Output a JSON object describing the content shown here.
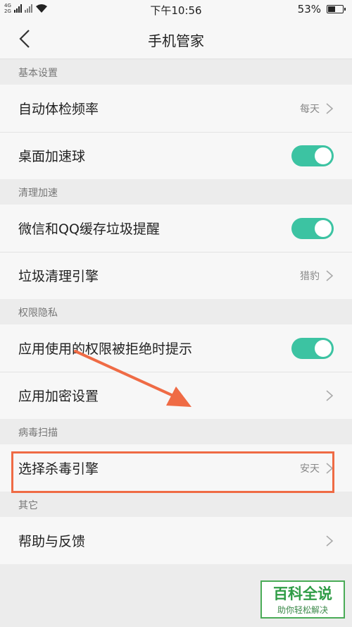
{
  "status_bar": {
    "network_top": "4G",
    "network_bottom": "2G",
    "time": "下午10:56",
    "battery_percent": "53%",
    "battery_level": 0.53
  },
  "header": {
    "title": "手机管家"
  },
  "sections": [
    {
      "title": "基本设置",
      "rows": [
        {
          "label": "自动体检频率",
          "value": "每天",
          "control": "chevron"
        },
        {
          "label": "桌面加速球",
          "control": "toggle",
          "on": true
        }
      ]
    },
    {
      "title": "清理加速",
      "rows": [
        {
          "label": "微信和QQ缓存垃圾提醒",
          "control": "toggle",
          "on": true
        },
        {
          "label": "垃圾清理引擎",
          "value": "猎豹",
          "control": "chevron"
        }
      ]
    },
    {
      "title": "权限隐私",
      "rows": [
        {
          "label": "应用使用的权限被拒绝时提示",
          "control": "toggle",
          "on": true
        },
        {
          "label": "应用加密设置",
          "control": "chevron"
        }
      ]
    },
    {
      "title": "病毒扫描",
      "rows": [
        {
          "label": "选择杀毒引擎",
          "value": "安天",
          "control": "chevron"
        }
      ]
    },
    {
      "title": "其它",
      "rows": [
        {
          "label": "帮助与反馈",
          "control": "chevron"
        }
      ]
    }
  ],
  "annotation": {
    "color": "#ef6b45"
  },
  "watermark": {
    "title": "百科全说",
    "subtitle": "助你轻松解决"
  },
  "colors": {
    "toggle_on": "#3cc3a2",
    "background": "#ececec",
    "row_bg": "#f7f7f7"
  }
}
